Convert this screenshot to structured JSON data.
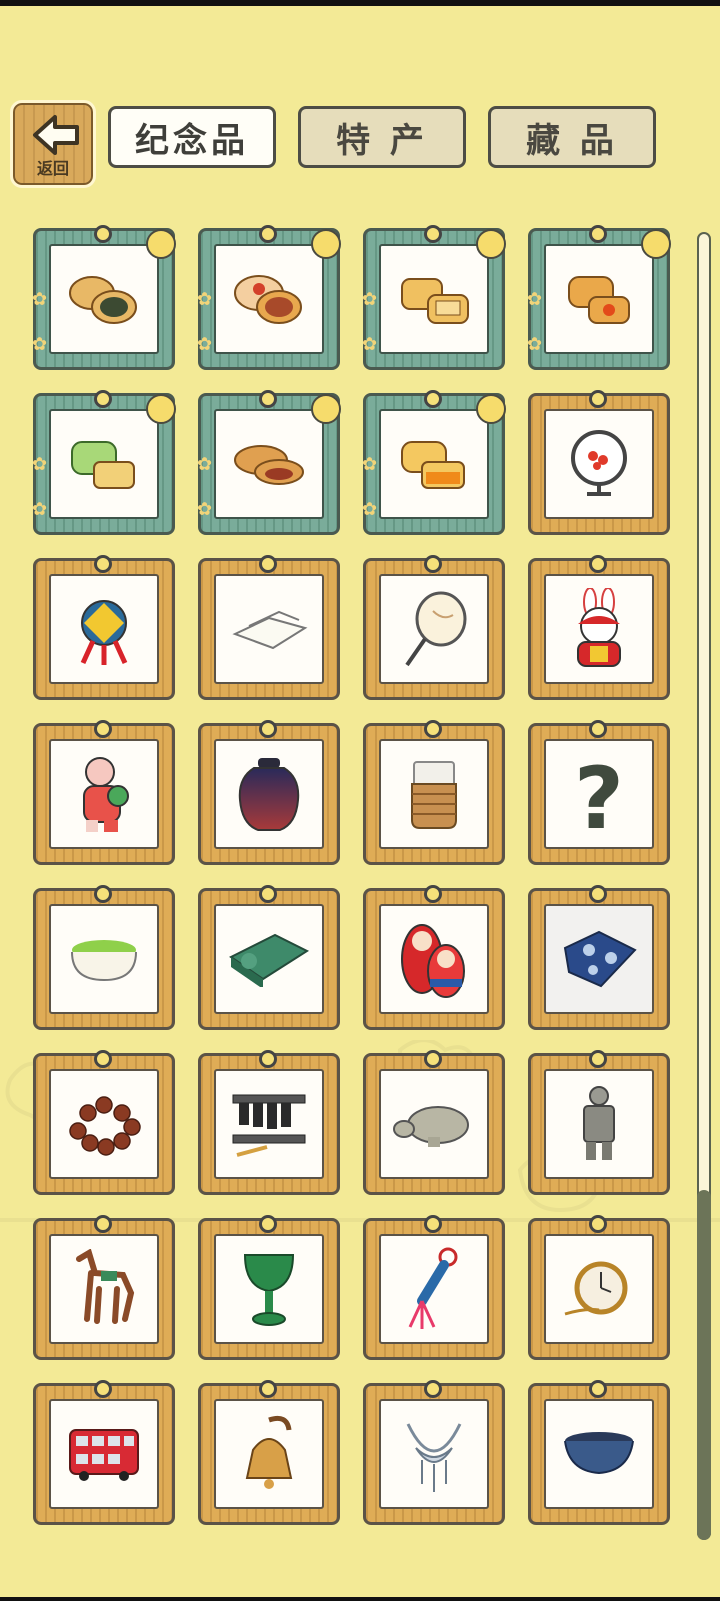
{
  "header": {
    "back_label": "返回",
    "tabs": [
      {
        "label": "纪念品",
        "active": true
      },
      {
        "label": "特 产",
        "active": false
      },
      {
        "label": "藏 品",
        "active": false
      }
    ]
  },
  "grid": {
    "items": [
      {
        "name": "mooncake-green-bean",
        "frame": "teal"
      },
      {
        "name": "mooncake-red-stamp",
        "frame": "teal"
      },
      {
        "name": "mooncake-pair-yellow",
        "frame": "teal"
      },
      {
        "name": "mooncake-egg-yolk",
        "frame": "teal"
      },
      {
        "name": "mooncake-green-tea",
        "frame": "teal"
      },
      {
        "name": "mooncake-brown",
        "frame": "teal"
      },
      {
        "name": "mooncake-orange",
        "frame": "teal"
      },
      {
        "name": "round-embroidery-screen",
        "frame": "wood"
      },
      {
        "name": "embroidered-ball",
        "frame": "wood"
      },
      {
        "name": "silk-cloth",
        "frame": "wood"
      },
      {
        "name": "round-fan",
        "frame": "wood"
      },
      {
        "name": "rabbit-figurine",
        "frame": "wood"
      },
      {
        "name": "clay-doll",
        "frame": "wood"
      },
      {
        "name": "lacquer-jar",
        "frame": "wood"
      },
      {
        "name": "woven-cup",
        "frame": "wood"
      },
      {
        "name": "unknown-item",
        "frame": "wood",
        "unknown": true
      },
      {
        "name": "matcha-bowl",
        "frame": "wood"
      },
      {
        "name": "jade-inkstone",
        "frame": "wood"
      },
      {
        "name": "matryoshka-dolls",
        "frame": "wood"
      },
      {
        "name": "blue-print-cloth",
        "frame": "wood"
      },
      {
        "name": "prayer-beads",
        "frame": "wood"
      },
      {
        "name": "chime-bells",
        "frame": "wood"
      },
      {
        "name": "stone-turtle",
        "frame": "wood"
      },
      {
        "name": "terracotta-warrior",
        "frame": "wood"
      },
      {
        "name": "tang-horse",
        "frame": "wood"
      },
      {
        "name": "jade-goblet",
        "frame": "wood"
      },
      {
        "name": "knot-tassel",
        "frame": "wood"
      },
      {
        "name": "pocket-watch",
        "frame": "wood"
      },
      {
        "name": "double-decker-bus",
        "frame": "wood"
      },
      {
        "name": "bell",
        "frame": "wood"
      },
      {
        "name": "silver-necklace",
        "frame": "wood"
      },
      {
        "name": "tea-bowl",
        "frame": "wood"
      }
    ],
    "unknown_symbol": "?"
  },
  "colors": {
    "background": "#f3ea96",
    "wood_frame": "#dfac56",
    "teal_frame": "#7aac9a",
    "tab_active": "#fffef7",
    "tab_inactive": "#e6ddbb"
  }
}
